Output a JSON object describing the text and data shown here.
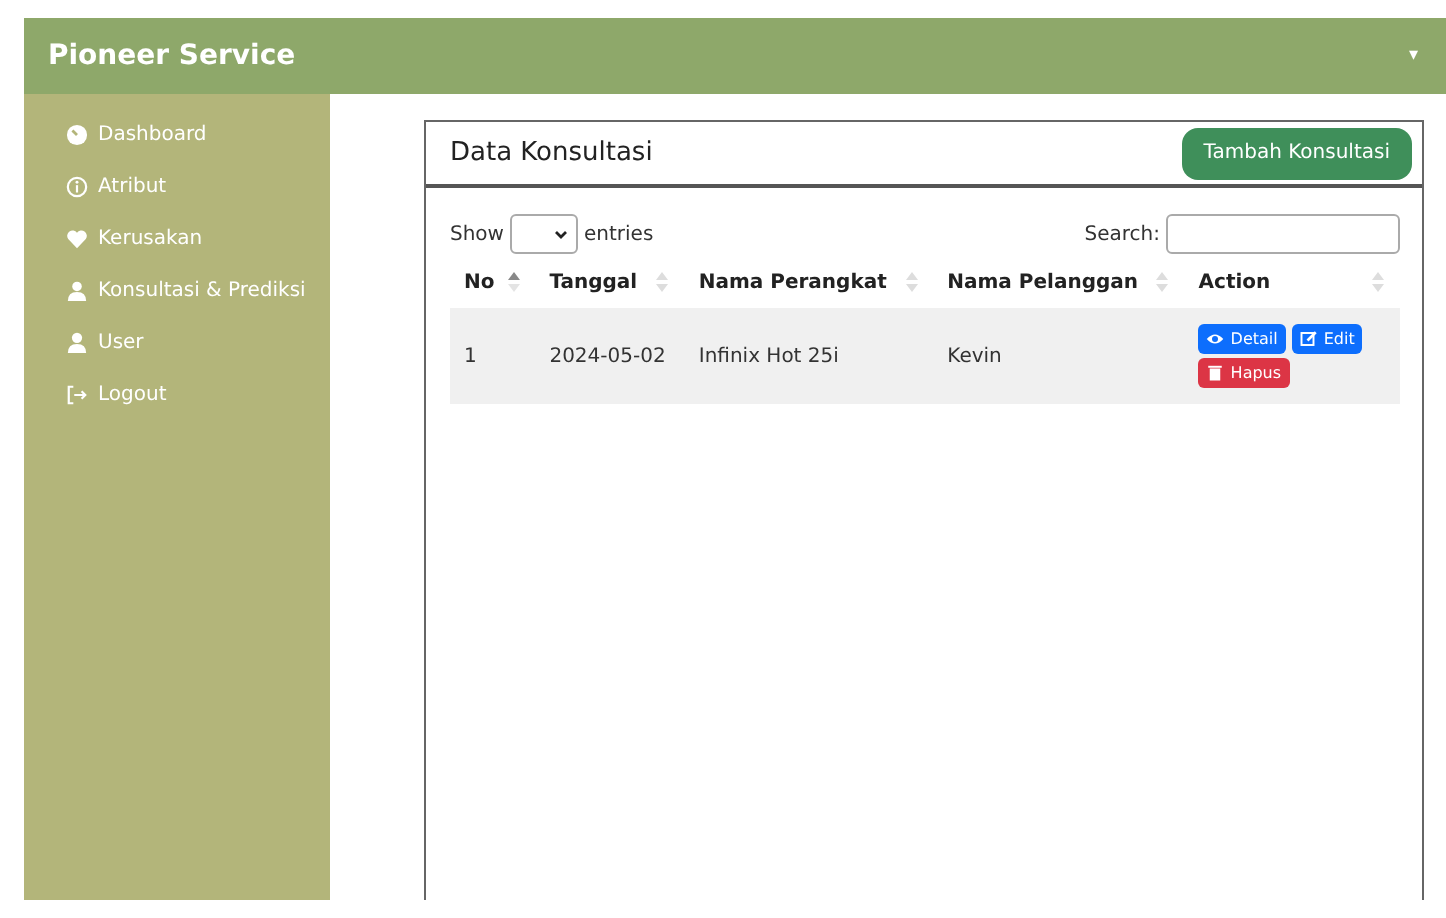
{
  "header": {
    "title": "Pioneer Service",
    "menu_caret": "▾"
  },
  "sidebar": {
    "items": [
      {
        "label": "Dashboard"
      },
      {
        "label": "Atribut"
      },
      {
        "label": "Kerusakan"
      },
      {
        "label": "Konsultasi & Prediksi"
      },
      {
        "label": "User"
      },
      {
        "label": "Logout"
      }
    ]
  },
  "card": {
    "title": "Data Konsultasi",
    "add_button": "Tambah Konsultasi"
  },
  "table_controls": {
    "show_label": "Show",
    "entries_label": "entries",
    "search_label": "Search:"
  },
  "table": {
    "columns": [
      {
        "label": "No",
        "sorted": true
      },
      {
        "label": "Tanggal",
        "sorted": false
      },
      {
        "label": "Nama Perangkat",
        "sorted": false
      },
      {
        "label": "Nama Pelanggan",
        "sorted": false
      },
      {
        "label": "Action",
        "sorted": false
      }
    ],
    "rows": [
      {
        "cells": [
          "1",
          "2024-05-02",
          "Infinix Hot 25i",
          "Kevin"
        ],
        "actions": [
          {
            "label": "Detail",
            "kind": "detail"
          },
          {
            "label": "Edit",
            "kind": "edit"
          },
          {
            "label": "Hapus",
            "kind": "delete"
          }
        ]
      }
    ]
  }
}
